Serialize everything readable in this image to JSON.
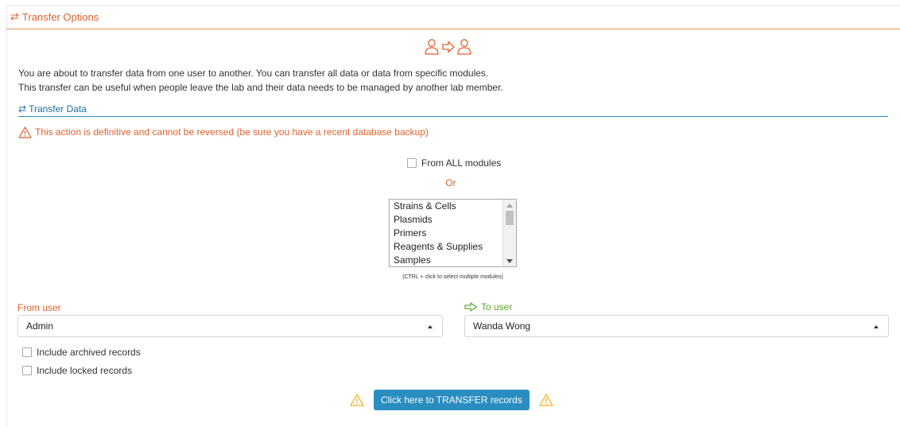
{
  "panel": {
    "title": "Transfer Options",
    "title_icon": "transfer-arrows-icon"
  },
  "hero": {
    "icon": "user-to-user-icon",
    "color": "#e2622c"
  },
  "intro": {
    "line1": "You are about to transfer data from one user to another. You can transfer all data or data from specific modules.",
    "line2": "This transfer can be useful when people leave the lab and their data needs to be managed by another lab member."
  },
  "section": {
    "title": "Transfer Data",
    "icon": "transfer-arrows-icon"
  },
  "warning": {
    "text": "This action is definitive and cannot be reversed (be sure you have a recent database backup)",
    "icon": "warning-triangle-icon"
  },
  "all_modules": {
    "label": "From ALL modules",
    "checked": false
  },
  "or_label": "Or",
  "modules": {
    "options": [
      "Strains & Cells",
      "Plasmids",
      "Primers",
      "Reagents & Supplies",
      "Samples"
    ],
    "hint": "(CTRL + click to select multiple modules)"
  },
  "from_user": {
    "label": "From user",
    "value": "Admin"
  },
  "to_user": {
    "label": "To user",
    "value": "Wanda Wong",
    "icon": "arrow-right-icon"
  },
  "include_archived": {
    "label": "Include archived records",
    "checked": false
  },
  "include_locked": {
    "label": "Include locked records",
    "checked": false
  },
  "action": {
    "button_label": "Click here to TRANSFER records",
    "icon": "warning-triangle-icon"
  },
  "colors": {
    "accent": "#e2622c",
    "primary": "#2a8dc0",
    "success": "#5ea829",
    "warning": "#f0b429"
  }
}
